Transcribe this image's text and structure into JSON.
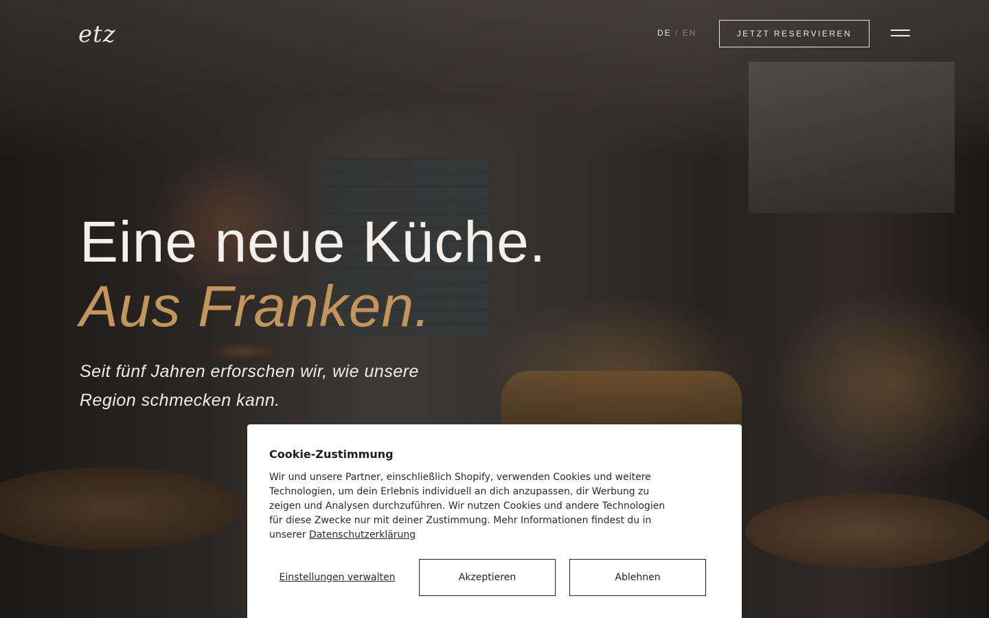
{
  "header": {
    "logo_text": "etz",
    "lang_de": "DE",
    "lang_sep": "/",
    "lang_en": "EN",
    "reserve_label": "JETZT RESERVIEREN",
    "menu_icon": "hamburger-menu-icon"
  },
  "hero": {
    "title_line1": "Eine neue Küche.",
    "title_line2": "Aus Franken.",
    "subtitle": "Seit fünf Jahren erforschen wir, wie unsere Region schmecken kann."
  },
  "cookie": {
    "title": "Cookie-Zustimmung",
    "text": "Wir und unsere Partner, einschließlich Shopify, verwenden Cookies und weitere Technologien, um dein Erlebnis individuell an dich anzupassen, dir Werbung zu zeigen und Analysen durchzuführen. Wir nutzen Cookies und andere Technologien für diese Zwecke nur mit deiner Zustimmung. Mehr Informationen findest du in unserer",
    "privacy_link": "Datenschutzerklärung",
    "manage_label": "Einstellungen verwalten",
    "accept_label": "Akzeptieren",
    "decline_label": "Ablehnen"
  },
  "colors": {
    "accent_gold": "#c2955d",
    "text_light": "#f3f0ec",
    "dialog_bg": "#ffffff"
  }
}
